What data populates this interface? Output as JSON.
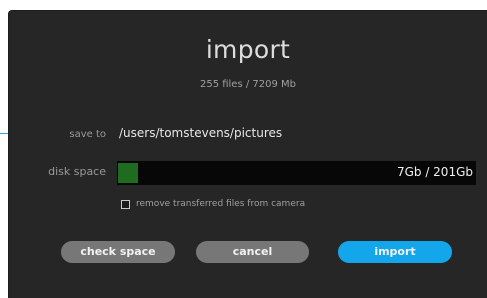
{
  "dialog": {
    "title": "import",
    "summary": "255 files / 7209 Mb"
  },
  "save_to": {
    "label": "save to",
    "path": "/users/tomstevens/pictures"
  },
  "disk_space": {
    "label": "disk space",
    "usage_text": "7Gb / 201Gb",
    "used_fraction": 0.035,
    "fill_color": "#1f6b1f"
  },
  "options": {
    "remove_label": "remove transferred files from camera",
    "remove_checked": false
  },
  "buttons": {
    "check_space": "check space",
    "cancel": "cancel",
    "import": "import"
  },
  "colors": {
    "accent": "#14a6ea",
    "secondary_button": "#777777",
    "dialog_background": "#262626"
  }
}
